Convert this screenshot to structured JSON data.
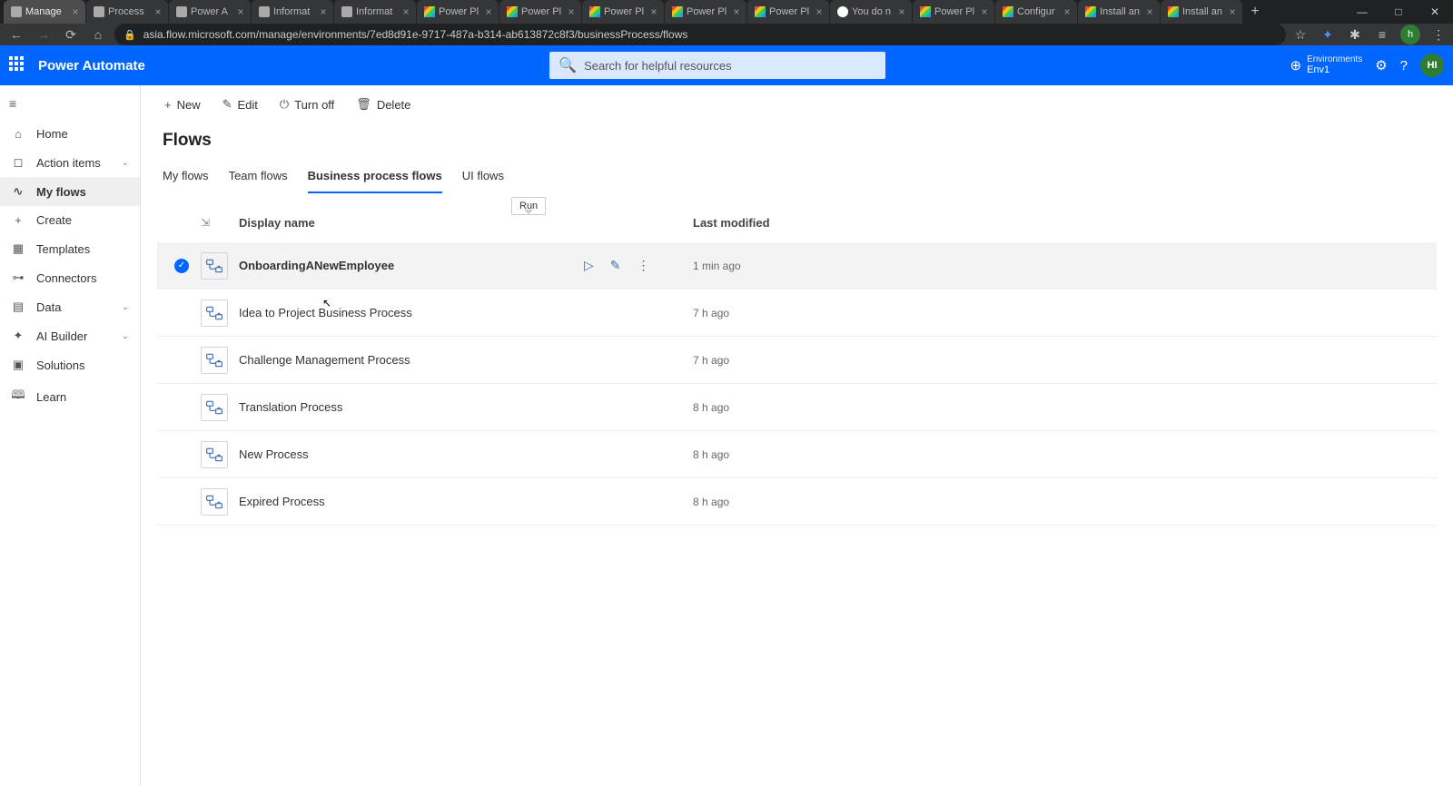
{
  "browser": {
    "tabs": [
      {
        "label": "Manage",
        "fav": "pa",
        "active": true
      },
      {
        "label": "Process",
        "fav": "pa"
      },
      {
        "label": "Power A",
        "fav": "pa"
      },
      {
        "label": "Informat",
        "fav": "inf"
      },
      {
        "label": "Informat",
        "fav": "inf"
      },
      {
        "label": "Power Pl",
        "fav": "pp"
      },
      {
        "label": "Power Pl",
        "fav": "pp"
      },
      {
        "label": "Power Pl",
        "fav": "pp"
      },
      {
        "label": "Power Pl",
        "fav": "pp"
      },
      {
        "label": "Power Pl",
        "fav": "pp"
      },
      {
        "label": "You do n",
        "fav": "g"
      },
      {
        "label": "Power Pl",
        "fav": "pp"
      },
      {
        "label": "Configur",
        "fav": "pp"
      },
      {
        "label": "Install an",
        "fav": "pp"
      },
      {
        "label": "Install an",
        "fav": "pp"
      }
    ],
    "url": "asia.flow.microsoft.com/manage/environments/7ed8d91e-9717-487a-b314-ab613872c8f3/businessProcess/flows",
    "avatar": "h"
  },
  "header": {
    "app_name": "Power Automate",
    "search_placeholder": "Search for helpful resources",
    "env_label": "Environments",
    "env_name": "Env1",
    "avatar": "HI"
  },
  "sidebar": {
    "items": [
      {
        "label": "Home",
        "icon": "⌂"
      },
      {
        "label": "Action items",
        "icon": "◻",
        "chevron": true
      },
      {
        "label": "My flows",
        "icon": "∿",
        "active": true
      },
      {
        "label": "Create",
        "icon": "+"
      },
      {
        "label": "Templates",
        "icon": "▦"
      },
      {
        "label": "Connectors",
        "icon": "⊶"
      },
      {
        "label": "Data",
        "icon": "▤",
        "chevron": true
      },
      {
        "label": "AI Builder",
        "icon": "✦",
        "chevron": true
      },
      {
        "label": "Solutions",
        "icon": "▣"
      },
      {
        "label": "Learn",
        "icon": "🕮"
      }
    ]
  },
  "toolbar": {
    "new": "New",
    "edit": "Edit",
    "turn_off": "Turn off",
    "delete": "Delete"
  },
  "page": {
    "title": "Flows",
    "tabs": [
      "My flows",
      "Team flows",
      "Business process flows",
      "UI flows"
    ],
    "active_tab_index": 2
  },
  "table": {
    "columns": {
      "name": "Display name",
      "modified": "Last modified"
    },
    "tooltip": "Run",
    "rows": [
      {
        "name": "OnboardingANewEmployee",
        "modified": "1 min ago",
        "selected": true
      },
      {
        "name": "Idea to Project Business Process",
        "modified": "7 h ago"
      },
      {
        "name": "Challenge Management Process",
        "modified": "7 h ago"
      },
      {
        "name": "Translation Process",
        "modified": "8 h ago"
      },
      {
        "name": "New Process",
        "modified": "8 h ago"
      },
      {
        "name": "Expired Process",
        "modified": "8 h ago"
      }
    ]
  }
}
